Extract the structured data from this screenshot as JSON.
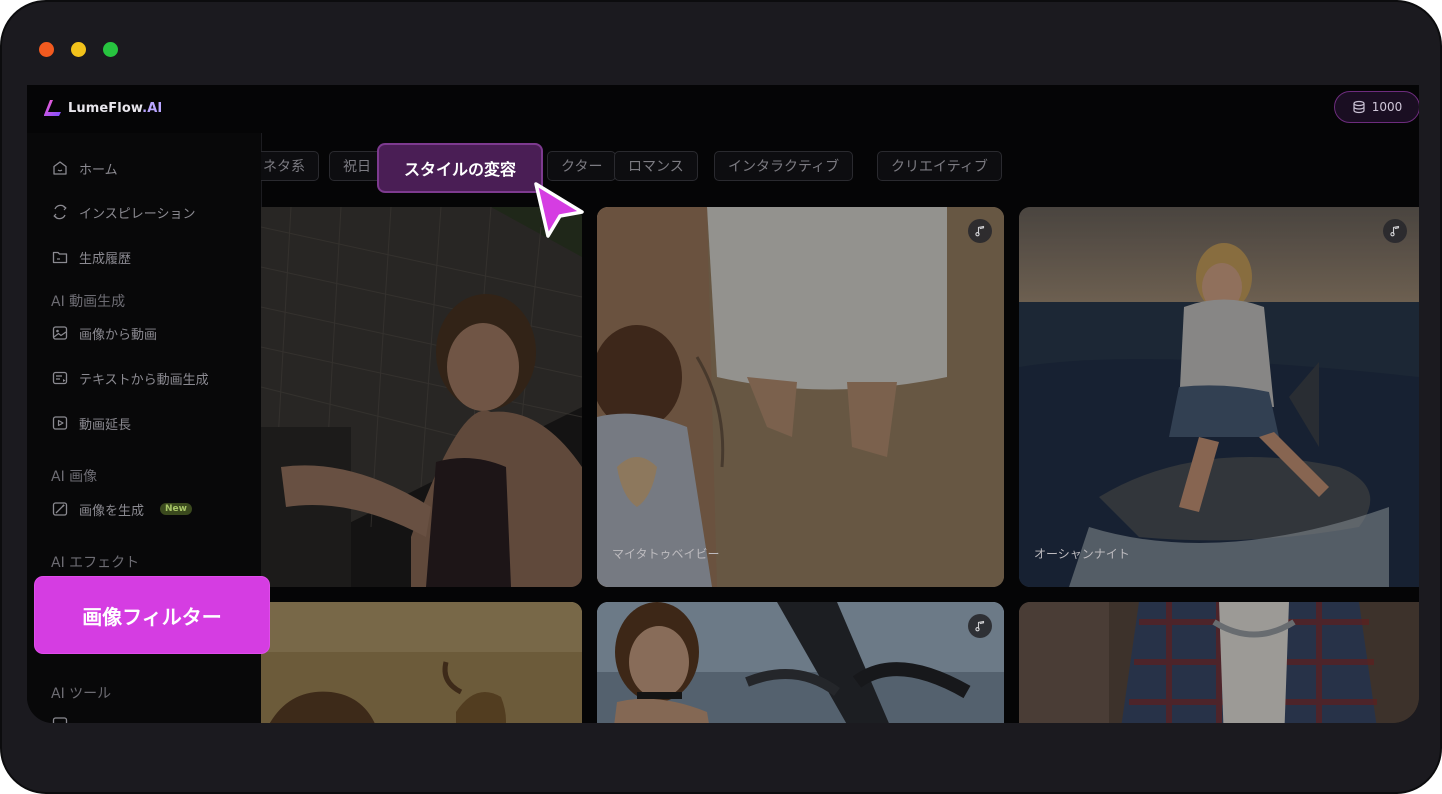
{
  "app": {
    "logo_main": "LumeFlow",
    "logo_suffix": ".AI",
    "credits": "1000"
  },
  "sidebar": {
    "items": [
      {
        "label": "ホーム",
        "icon": "home-icon"
      },
      {
        "label": "インスピレーション",
        "icon": "inspiration-icon"
      },
      {
        "label": "生成履歴",
        "icon": "folder-icon"
      }
    ],
    "sections": [
      {
        "title": "AI 動画生成",
        "items": [
          {
            "label": "画像から動画",
            "icon": "image-icon"
          },
          {
            "label": "テキストから動画生成",
            "icon": "text-video-icon"
          },
          {
            "label": "動画延長",
            "icon": "video-extend-icon"
          }
        ]
      },
      {
        "title": "AI 画像",
        "items": [
          {
            "label": "画像を生成",
            "icon": "image-generate-icon",
            "badge": "New"
          }
        ]
      },
      {
        "title": "AI エフェクト",
        "items": []
      },
      {
        "title": "AI ツール",
        "items": []
      }
    ],
    "highlight": "画像フィルター"
  },
  "tabs": [
    {
      "label": "ネタ系"
    },
    {
      "label": "祝日"
    },
    {
      "label": "スタイルの変容",
      "active": true
    },
    {
      "label": "クター"
    },
    {
      "label": "ロマンス"
    },
    {
      "label": "インタラクティブ"
    },
    {
      "label": "クリエイティブ"
    }
  ],
  "cards": [
    {
      "label": "",
      "music": false
    },
    {
      "label": "マイタトゥベイビー",
      "music": true
    },
    {
      "label": "オーシャンナイト",
      "music": true
    },
    {
      "label": "",
      "music": false
    },
    {
      "label": "",
      "music": true
    },
    {
      "label": "",
      "music": false
    }
  ],
  "colors": {
    "accent": "#d53de2",
    "active_tab": "#4a1e55",
    "credits_border": "#6d2c7d"
  }
}
